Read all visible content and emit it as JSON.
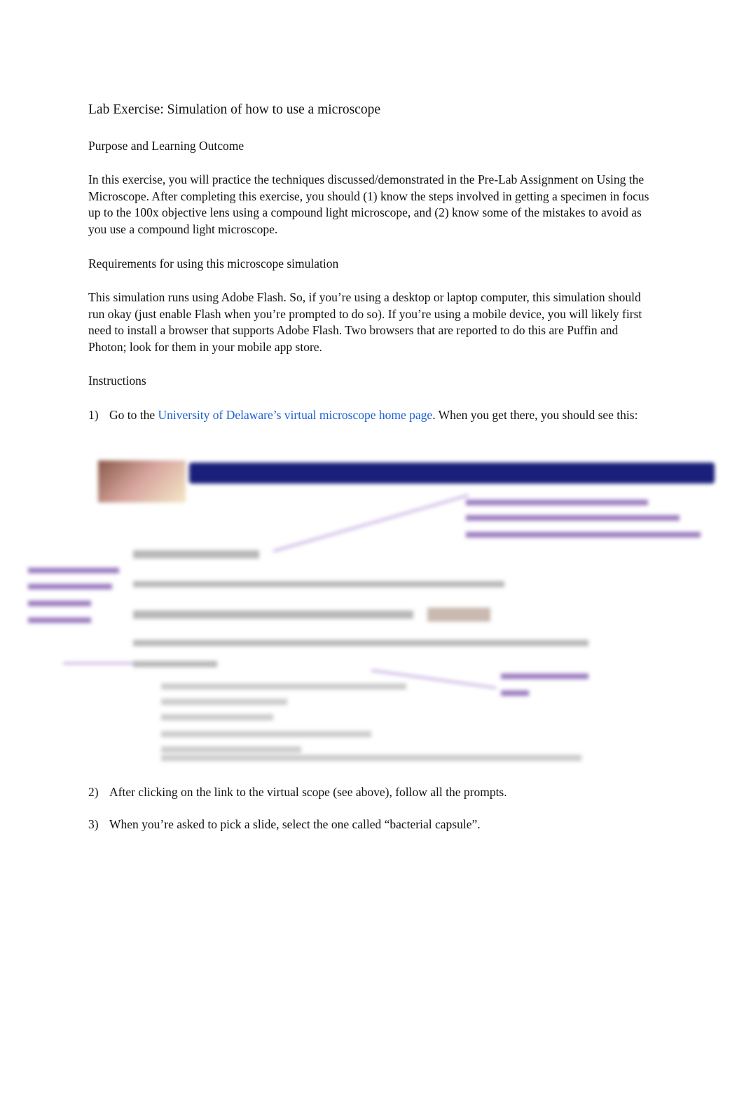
{
  "title": "Lab Exercise: Simulation of how to use a microscope",
  "sections": {
    "purpose": {
      "heading": "Purpose and Learning Outcome",
      "body": "In this exercise, you will practice the techniques discussed/demonstrated in the Pre-Lab Assignment on Using the Microscope. After completing this exercise, you should (1) know the steps involved in getting a specimen in focus up to the 100x objective lens using a compound light microscope, and (2) know some of the mistakes to avoid as you use a compound light microscope."
    },
    "requirements": {
      "heading": "Requirements for using this microscope simulation",
      "body": "This simulation runs using Adobe Flash. So, if you’re using a desktop or laptop computer, this simulation should run okay (just enable Flash when you’re prompted to do so). If you’re using a mobile device, you will likely first need to install a browser that supports Adobe Flash. Two browsers that are reported to do this are Puffin and Photon; look for them in your mobile app store."
    },
    "instructions": {
      "heading": "Instructions",
      "steps": [
        {
          "num": "1)",
          "pre": "Go to the ",
          "link": "University of Delaware’s virtual microscope home page",
          "post": ". When you get there, you should see this:"
        },
        {
          "num": "2)",
          "text": "After clicking on the link to the virtual scope (see above), follow all the prompts."
        },
        {
          "num": "3)",
          "text": "When you’re asked to pick a slide, select the one called “bacterial capsule”."
        }
      ]
    }
  },
  "colors": {
    "link": "#1a5fd1",
    "banner": "#1a1f7a",
    "annotation": "#9b7bbf"
  }
}
